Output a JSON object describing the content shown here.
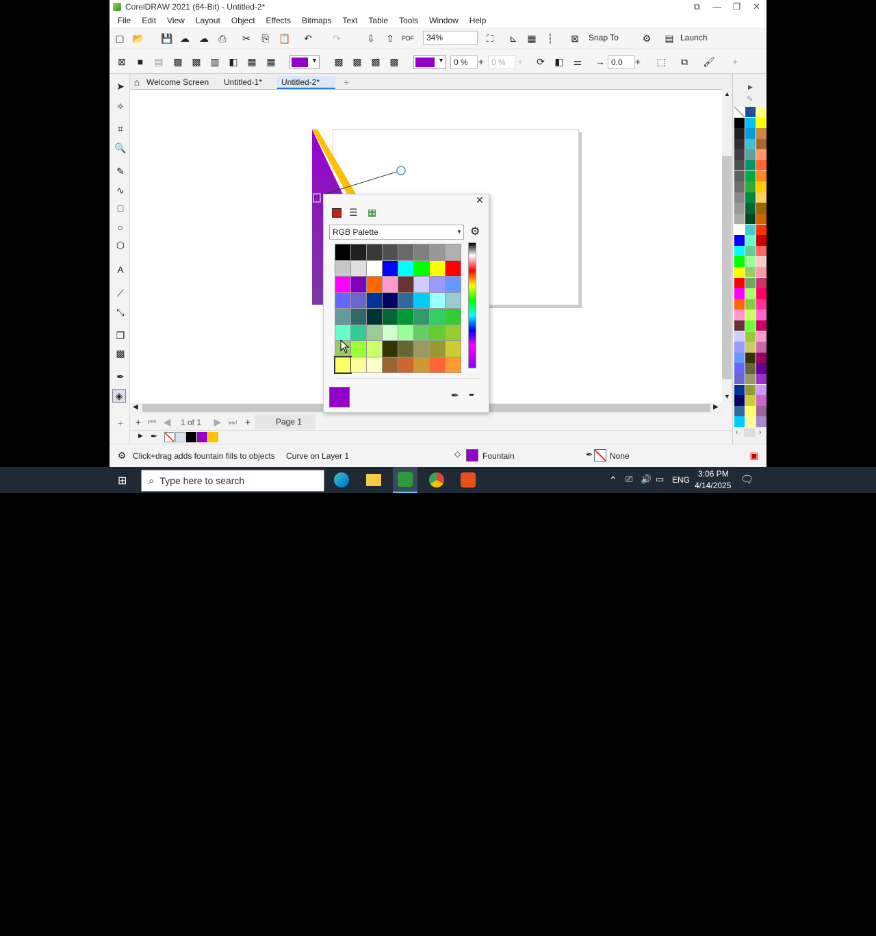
{
  "window": {
    "title": "CorelDRAW 2021 (64-Bit) - Untitled-2*",
    "min": "—",
    "max": "❐",
    "close": "✕",
    "restore": "⧉"
  },
  "menu": [
    "File",
    "Edit",
    "View",
    "Layout",
    "Object",
    "Effects",
    "Bitmaps",
    "Text",
    "Table",
    "Tools",
    "Window",
    "Help"
  ],
  "toolbar": {
    "zoom": "34%",
    "snap_to": "Snap To",
    "launch": "Launch"
  },
  "propbar": {
    "opacity1": "0 %",
    "opacity2": "0 %",
    "angle": "0.0",
    "fill_color": "#9400c8"
  },
  "tabs": {
    "welcome": "Welcome Screen",
    "doc1": "Untitled-1*",
    "doc2": "Untitled-2*"
  },
  "popup": {
    "palette_name": "RGB Palette",
    "close": "✕",
    "more": "•••",
    "current_color": "#9400c8",
    "swatches": [
      "#000000",
      "#202020",
      "#383838",
      "#505050",
      "#686868",
      "#808080",
      "#989898",
      "#b0b0b0",
      "#c8c8c8",
      "#e0e0e0",
      "#ffffff",
      "#0000ff",
      "#00ffff",
      "#00ff00",
      "#ffff00",
      "#ff0000",
      "#ff00ff",
      "#8000c0",
      "#ff6600",
      "#ff99cc",
      "#663333",
      "#ccccff",
      "#9999ff",
      "#6699ff",
      "#6666ff",
      "#6666cc",
      "#003399",
      "#000066",
      "#336699",
      "#00ccff",
      "#99ffff",
      "#99cccc",
      "#669999",
      "#336666",
      "#003333",
      "#006633",
      "#009933",
      "#339966",
      "#33cc66",
      "#33cc33",
      "#66ffcc",
      "#33cc99",
      "#99cc99",
      "#ccffcc",
      "#99ff99",
      "#66cc66",
      "#66cc33",
      "#99cc33",
      "#99cc66",
      "#99ff33",
      "#ccff66",
      "#333300",
      "#666633",
      "#999966",
      "#999933",
      "#cccc33",
      "#ffff66",
      "#ffff99",
      "#ffffcc",
      "#996633",
      "#cc6633",
      "#cc9933",
      "#ff6633",
      "#ff9933"
    ]
  },
  "page_nav": {
    "count": "1 of 1",
    "page_tab": "Page 1"
  },
  "status": {
    "hint": "Click+drag adds fountain fills to objects",
    "object": "Curve on Layer 1",
    "fill": "Fountain",
    "outline": "None"
  },
  "taskbar": {
    "search_placeholder": "Type here to search",
    "lang": "ENG",
    "time": "3:06 PM",
    "date": "4/14/2025"
  },
  "side_palette": [
    [
      "#ffffff",
      "#1f4f9c",
      "#ffff80"
    ],
    [
      "#000000",
      "#00c0ff",
      "#ffff00"
    ],
    [
      "#202020",
      "#00a0e0",
      "#cc8844"
    ],
    [
      "#303030",
      "#40c0d0",
      "#aa6633"
    ],
    [
      "#404040",
      "#60a0a0",
      "#ff9966"
    ],
    [
      "#505050",
      "#009966",
      "#ff6633"
    ],
    [
      "#606060",
      "#00aa44",
      "#ff8822"
    ],
    [
      "#707070",
      "#33aa33",
      "#ffcc00"
    ],
    [
      "#888888",
      "#008844",
      "#ffcc66"
    ],
    [
      "#999999",
      "#006633",
      "#996600"
    ],
    [
      "#aaaaaa",
      "#004422",
      "#cc6600"
    ],
    [
      "#ffffff",
      "#44cccc",
      "#ff3300"
    ],
    [
      "#0000ff",
      "#66ffcc",
      "#cc0000"
    ],
    [
      "#00ffff",
      "#66cc99",
      "#ff6666"
    ],
    [
      "#00ff00",
      "#99ff99",
      "#ffcccc"
    ],
    [
      "#ffff00",
      "#99cc66",
      "#ff99aa"
    ],
    [
      "#ff0000",
      "#66aa66",
      "#cc3366"
    ],
    [
      "#ff00ff",
      "#aaff66",
      "#ff0066"
    ],
    [
      "#ff6600",
      "#88cc44",
      "#ff3399"
    ],
    [
      "#ff99cc",
      "#ccff66",
      "#ff66cc"
    ],
    [
      "#663333",
      "#66ff33",
      "#cc0066"
    ],
    [
      "#ccccff",
      "#99cc33",
      "#ff99cc"
    ],
    [
      "#9999ff",
      "#cccc66",
      "#cc66aa"
    ],
    [
      "#6699ff",
      "#333300",
      "#990066"
    ],
    [
      "#6666ff",
      "#666633",
      "#660099"
    ],
    [
      "#6666cc",
      "#999966",
      "#9933cc"
    ],
    [
      "#003399",
      "#999933",
      "#cc99ff"
    ],
    [
      "#000066",
      "#cccc33",
      "#cc66cc"
    ],
    [
      "#336699",
      "#ffff66",
      "#996699"
    ],
    [
      "#00ccff",
      "#ffff99",
      "#aa88cc"
    ]
  ]
}
